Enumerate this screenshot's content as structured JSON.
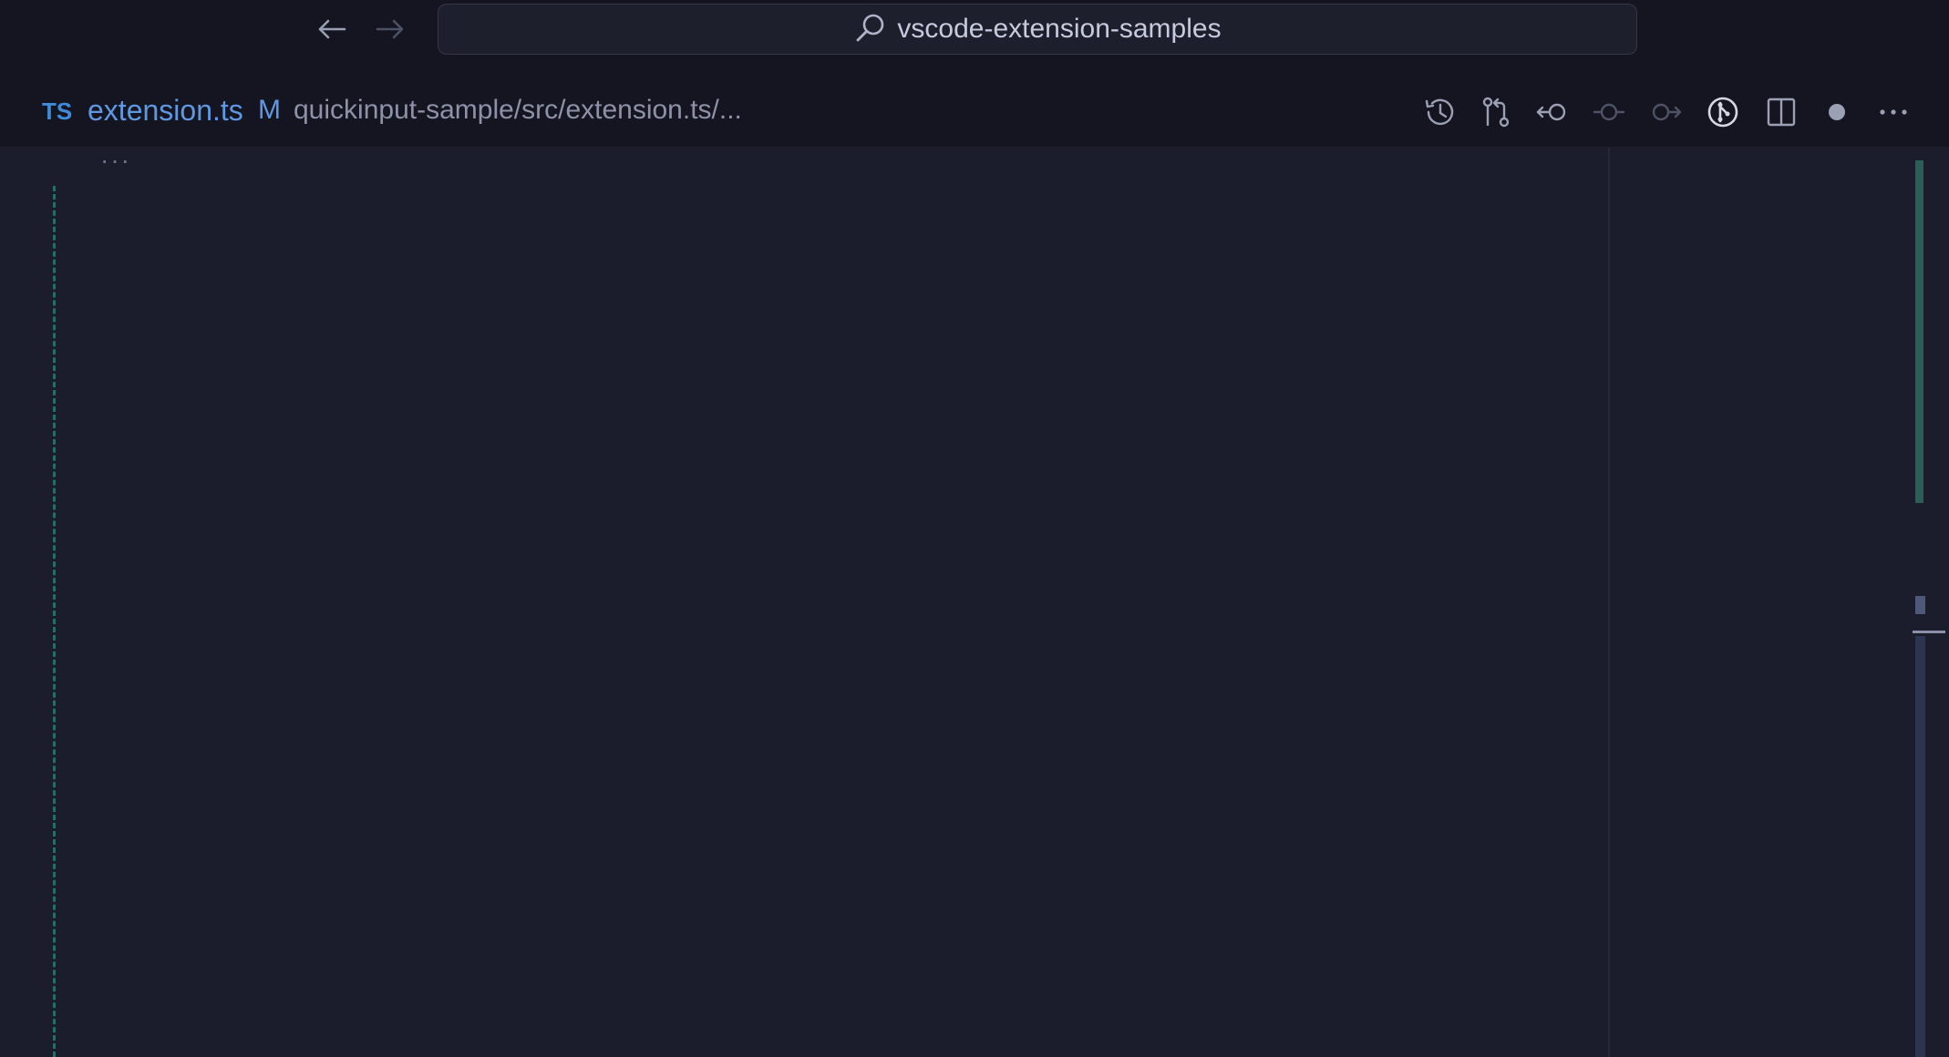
{
  "titlebar": {
    "search_text": "vscode-extension-samples"
  },
  "icons": {
    "back": "arrow-left-icon",
    "forward": "arrow-right-icon",
    "search": "search-icon",
    "timeline": "history-icon",
    "compare": "compare-changes-icon",
    "prev_change": "previous-change-icon",
    "current_change": "change-icon",
    "next_change": "next-change-icon",
    "source_control": "git-icon",
    "split": "split-editor-icon",
    "dirty": "dot-icon",
    "more": "ellipsis-icon"
  },
  "tab": {
    "language_badge": "TS",
    "filename": "extension.ts",
    "modified_flag": "M",
    "breadcrumb": "quickinput-sample/src/extension.ts/..."
  },
  "editor": {
    "fold_marker": "···"
  },
  "colors": {
    "accent_blue": "#5f98e0",
    "ts_badge": "#3f8bd8",
    "background": "#1b1c2c",
    "guide_green": "#2c6a63"
  }
}
